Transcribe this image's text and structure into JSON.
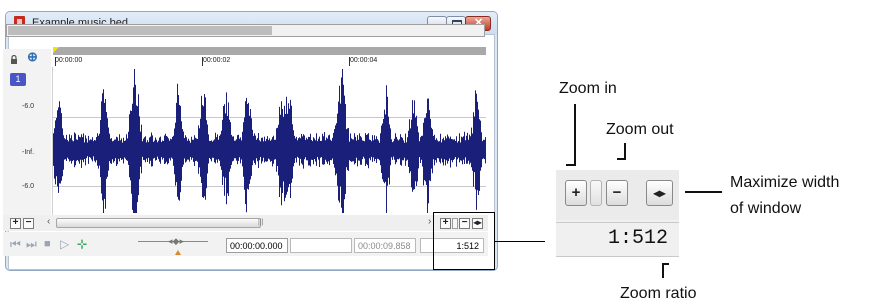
{
  "window": {
    "title": "Example music bed",
    "timecodes": [
      "00:00:00",
      "00:00:02",
      "00:00:04"
    ],
    "track_number": "1",
    "db_labels": [
      "-6.0",
      "-Inf.",
      "-6.0"
    ],
    "fields": {
      "cursor_position": "00:00:00.000",
      "selection": "",
      "length": "00:00:09.858",
      "zoom_ratio": "1:512"
    },
    "icons": [
      "app-icon",
      "minimize-icon",
      "maximize-icon",
      "close-icon",
      "lock-icon",
      "snap-icon",
      "go-to-start-icon",
      "go-to-end-icon",
      "stop-icon",
      "play-icon",
      "loop-play-icon",
      "zoom-in-icon",
      "zoom-out-icon",
      "maximize-width-icon"
    ],
    "colors": {
      "waveform": "#1a1f7a",
      "track_badge": "#4b56c6",
      "title_icon": "#c42b1c"
    }
  },
  "callout": {
    "zoom_in_label": "Zoom in",
    "zoom_out_label": "Zoom out",
    "maximize_label_line1": "Maximize width",
    "maximize_label_line2": "of window",
    "zoom_ratio_label": "Zoom ratio",
    "zoom_ratio_value": "1:512",
    "plus_glyph": "+",
    "minus_glyph": "−",
    "max_glyph": "◂▸"
  }
}
